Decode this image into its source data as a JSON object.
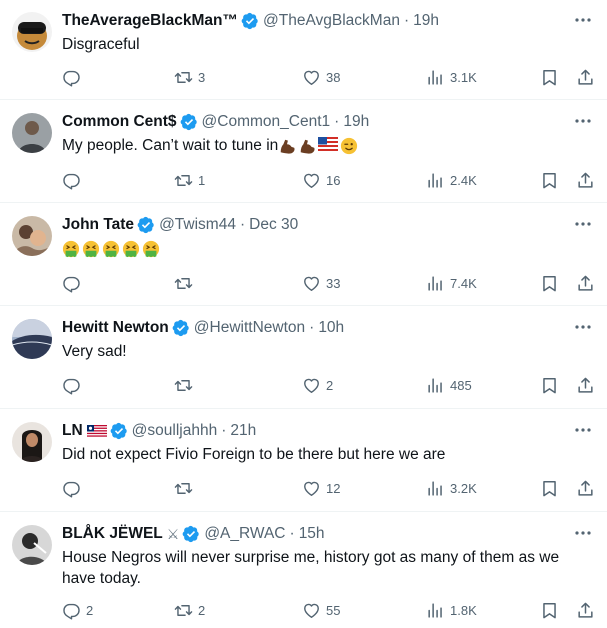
{
  "tweets": [
    {
      "name": "TheAverageBlackMan™",
      "handle": "@TheAvgBlackMan",
      "separator": "·",
      "time": "19h",
      "text": "Disgraceful",
      "replies": "",
      "retweets": "3",
      "likes": "38",
      "views": "3.1K"
    },
    {
      "name": "Common Cent$",
      "handle": "@Common_Cent1",
      "separator": "·",
      "time": "19h",
      "text": "My people. Can’t wait to tune in",
      "emoji": [
        "flexed-biceps-emoji",
        "flexed-biceps-emoji",
        "us-flag-emoji",
        "winking-face-emoji"
      ],
      "replies": "",
      "retweets": "1",
      "likes": "16",
      "views": "2.4K"
    },
    {
      "name": "John Tate",
      "handle": "@Twism44",
      "separator": "·",
      "time": "Dec 30",
      "text": "",
      "emoji": [
        "vomiting-face-emoji",
        "vomiting-face-emoji",
        "vomiting-face-emoji",
        "vomiting-face-emoji",
        "vomiting-face-emoji"
      ],
      "replies": "",
      "retweets": "",
      "likes": "33",
      "views": "7.4K"
    },
    {
      "name": "Hewitt Newton",
      "handle": "@HewittNewton",
      "separator": "·",
      "time": "10h",
      "text": "Very sad!",
      "replies": "",
      "retweets": "",
      "likes": "2",
      "views": "485"
    },
    {
      "name": "LN",
      "name_flag": "liberia-flag-emoji",
      "handle": "@soulljahhh",
      "separator": "·",
      "time": "21h",
      "text": "Did not expect Fivio Foreign to be there but here we are",
      "replies": "",
      "retweets": "",
      "likes": "12",
      "views": "3.2K"
    },
    {
      "name": "BLÅK JËWEL",
      "name_icon": "crossed-swords-emoji",
      "handle": "@A_RWAC",
      "separator": "·",
      "time": "15h",
      "text": "House Negros will never surprise me, history got as many of them as we have today.",
      "replies": "2",
      "retweets": "2",
      "likes": "55",
      "views": "1.8K"
    }
  ],
  "colors": {
    "text_primary": "#0f1419",
    "text_secondary": "#536471",
    "verified_blue": "#1d9bf0",
    "divider": "#eff3f4"
  }
}
